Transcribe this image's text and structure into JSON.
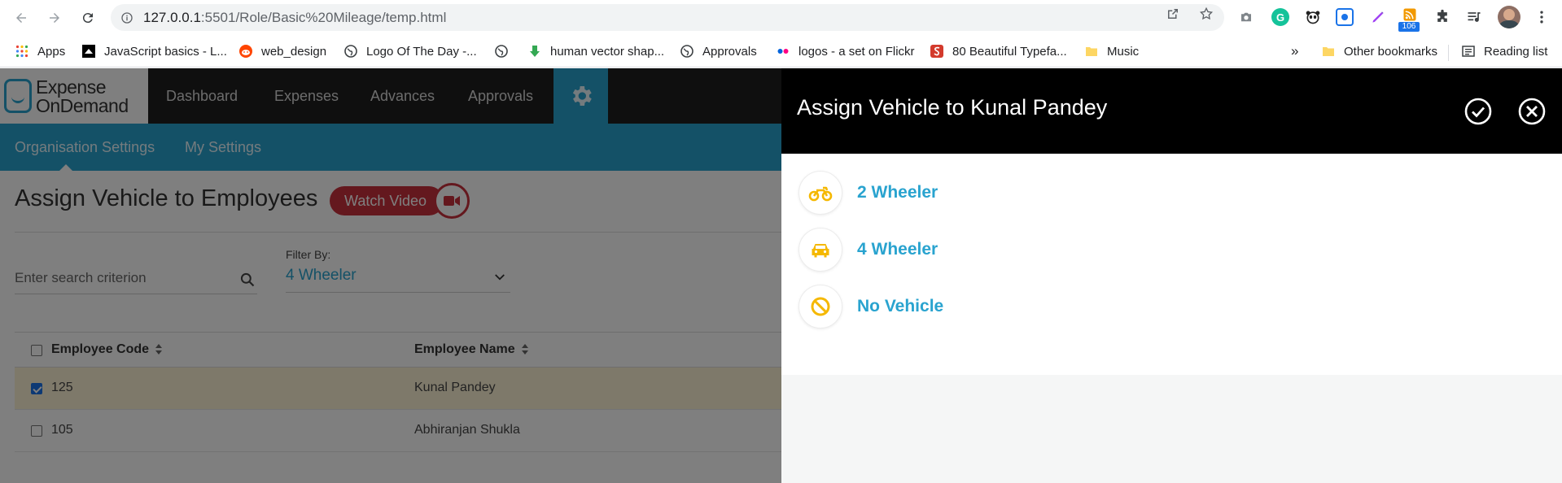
{
  "browser": {
    "url_host": "127.0.0.1",
    "url_path": ":5501/Role/Basic%20Mileage/temp.html",
    "extension_badge": "106",
    "bookmarks": [
      {
        "label": "Apps"
      },
      {
        "label": "JavaScript basics - L..."
      },
      {
        "label": "web_design"
      },
      {
        "label": "Logo Of The Day -..."
      },
      {
        "label": ""
      },
      {
        "label": "human vector shap..."
      },
      {
        "label": "Approvals"
      },
      {
        "label": "logos - a set on Flickr"
      },
      {
        "label": "80 Beautiful Typefa..."
      },
      {
        "label": "Music"
      }
    ],
    "overflow": "»",
    "other_bookmarks": "Other bookmarks",
    "reading_list": "Reading list"
  },
  "app": {
    "logo_line1": "Expense",
    "logo_line2": "OnDemand",
    "nav": [
      "Dashboard",
      "Expenses",
      "Advances",
      "Approvals"
    ],
    "subnav": [
      "Organisation Settings",
      "My Settings"
    ],
    "page_title": "Assign Vehicle to Employees",
    "watch_video": "Watch Video",
    "search_placeholder": "Enter search criterion",
    "filter_label": "Filter By:",
    "filter_value": "4 Wheeler",
    "table": {
      "headers": [
        "Employee Code",
        "Employee Name"
      ],
      "rows": [
        {
          "code": "125",
          "name": "Kunal Pandey",
          "checked": true
        },
        {
          "code": "105",
          "name": "Abhiranjan Shukla",
          "checked": false
        }
      ]
    }
  },
  "panel": {
    "title": "Assign Vehicle to Kunal Pandey",
    "options": [
      {
        "label": "2 Wheeler",
        "icon": "motorcycle-icon"
      },
      {
        "label": "4 Wheeler",
        "icon": "car-icon"
      },
      {
        "label": "No Vehicle",
        "icon": "ban-icon"
      }
    ],
    "accent": "#29a3cf",
    "icon_color": "#f5b800"
  }
}
